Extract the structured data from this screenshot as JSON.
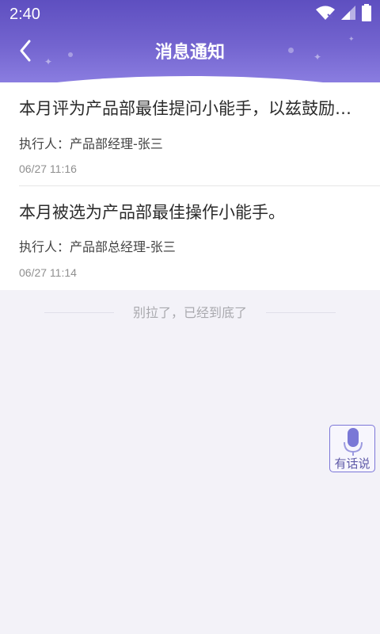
{
  "status_bar": {
    "time": "2:40",
    "icons": [
      "wifi-icon",
      "signal-icon",
      "battery-icon"
    ]
  },
  "header": {
    "title": "消息通知",
    "back_icon": "chevron-left-icon"
  },
  "notifications": [
    {
      "title": "本月评为产品部最佳提问小能手，以兹鼓励，再接再厉",
      "executor": "执行人：产品部经理-张三",
      "time": "06/27 11:16"
    },
    {
      "title": "本月被选为产品部最佳操作小能手。",
      "executor": "执行人：产品部总经理-张三",
      "time": "06/27 11:14"
    }
  ],
  "footer": {
    "end_text": "别拉了，已经到底了"
  },
  "voice_button": {
    "label": "有话说",
    "icon": "microphone-icon"
  },
  "colors": {
    "header_top": "#5e4fc0",
    "header_bottom": "#8a7de0",
    "background": "#f3f2f8",
    "accent": "#7c76d8"
  }
}
